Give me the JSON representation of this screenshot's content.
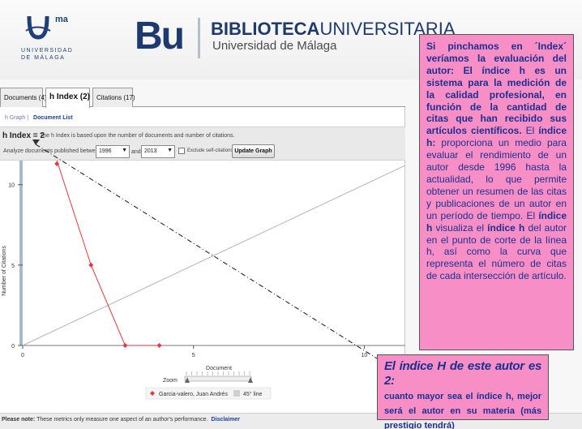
{
  "header": {
    "uma_superscript": "ma",
    "uma_line1": "UNIVERSIDAD",
    "uma_line2": "DE MÁLAGA",
    "bu_logo": "Bu",
    "title_bold": "BIBLIOTECA",
    "title_rest": "UNIVERSITARIA",
    "subtitle": "Universidad de Málaga"
  },
  "tabs": [
    {
      "label": "Documents (4)",
      "active": false
    },
    {
      "label": "h Index (2)",
      "active": true
    },
    {
      "label": "Citations (17)",
      "active": false
    }
  ],
  "subnav": {
    "graph": "h Graph",
    "separator": "|",
    "doclist": "Document List"
  },
  "hindex": {
    "label": "h Index = 2",
    "description": "The h Index is based upon the number of documents and number of citations."
  },
  "controls": {
    "analyze_label": "Analyze documents published between:",
    "from_year": "1996",
    "and_label": "and",
    "to_year": "2013",
    "exclude_label": "Exclude self-citations",
    "update_button": "Update Graph"
  },
  "chart_data": {
    "type": "scatter",
    "title": "",
    "xlabel": "Document",
    "ylabel": "Number of Citations",
    "xlim": [
      0,
      11.2
    ],
    "ylim": [
      0,
      11.5
    ],
    "x_ticks": [
      0,
      5,
      10
    ],
    "y_ticks": [
      0,
      5,
      10
    ],
    "series": [
      {
        "name": "Garcia-valero, Juan Andrés",
        "color": "#e8363c",
        "points": [
          [
            1,
            11.6
          ],
          [
            2,
            5
          ],
          [
            3,
            0
          ],
          [
            4,
            0
          ]
        ]
      },
      {
        "name": "45° line",
        "color": "#b5b5b5",
        "points": [
          [
            0,
            0
          ],
          [
            11.2,
            11.2
          ]
        ]
      }
    ],
    "legend": {
      "entries": [
        "Garcia-valero, Juan Andrés",
        "45° line"
      ]
    },
    "zoom_label": "Zoom"
  },
  "footer": {
    "note_label": "Please note:",
    "note_text": "These metrics only measure one aspect of an author's performance.",
    "disclaimer": "Disclaimer"
  },
  "annotation1": {
    "p1": "Si pinchamos en ´Index´ veríamos la evaluación del autor: El índice h es un sistema para la medición de la calidad profesional, en función de la cantidad de citas que han recibido sus artículos científicos.",
    "p2a": "El",
    "p2b": "índice h:",
    "p2c": "proporciona un medio para evaluar el rendimiento de un autor desde 1996 hasta la actualidad, lo que permite obtener un resumen de las citas y publicaciones de un autor en un período de tiempo. El",
    "p2d": "índice h",
    "p2e": "visualiza el",
    "p2f": "índice h",
    "p2g": "del autor en el punto de corte de la línea h, así como la curva que representa el número de citas de cada intersección de artículo."
  },
  "annotation2": {
    "heading": "El índice H de este autor es 2:",
    "text": "cuanto mayor sea el índice h, mejor será el autor en su materia (más prestigio tendrá)"
  }
}
